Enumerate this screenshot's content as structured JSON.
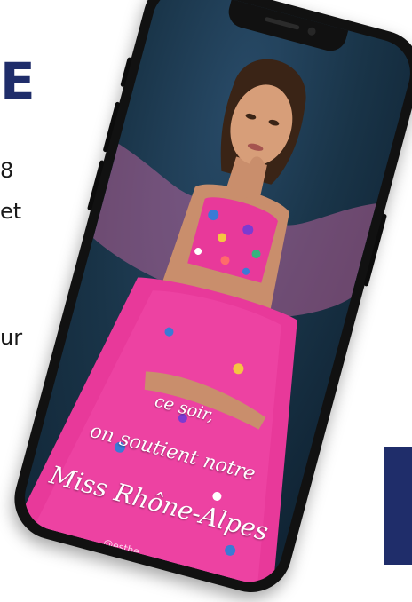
{
  "background": {
    "title_fragment": "E",
    "line1": "8",
    "line2": "et",
    "line3": "ur",
    "accent_color": "#1f2d6a"
  },
  "phone": {
    "story": {
      "line1": "ce soir,",
      "line2": "on soutient notre",
      "line3": "Miss Rhône-Alpes",
      "handle": "@esthe"
    },
    "dress_color": "#e8399a",
    "backdrop_color": "#193448"
  }
}
